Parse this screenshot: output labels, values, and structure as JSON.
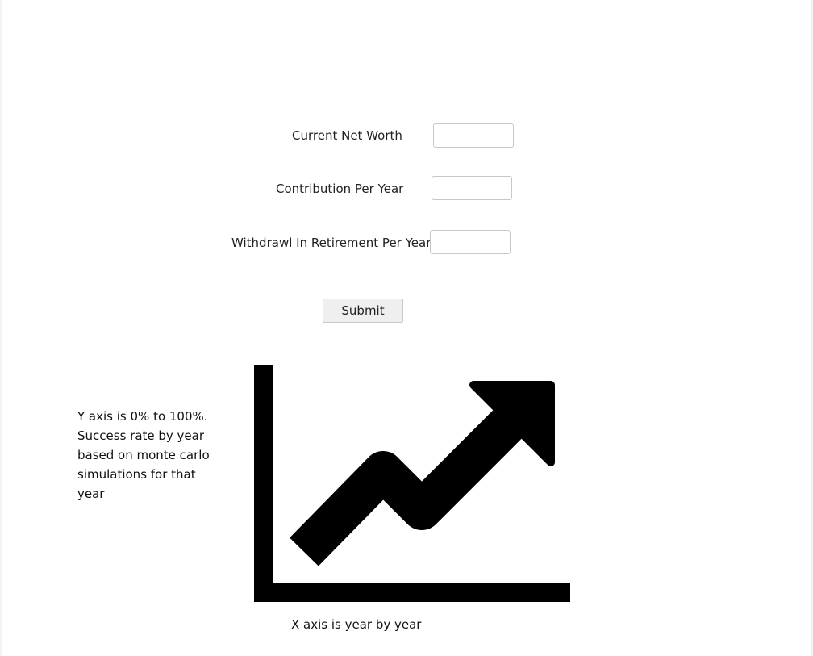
{
  "form": {
    "fields": [
      {
        "label": "Current Net Worth",
        "value": "",
        "placeholder": ""
      },
      {
        "label": "Contribution Per Year",
        "value": "",
        "placeholder": ""
      },
      {
        "label": "Withdrawl In Retirement Per Year",
        "value": "",
        "placeholder": ""
      }
    ],
    "submit_label": "Submit"
  },
  "chart_area": {
    "icon": "trending-up-chart-icon",
    "y_axis_note": "Y axis is 0% to 100%. Success rate by year based on monte carlo simulations for that year",
    "x_axis_note": "X axis is year by year"
  }
}
